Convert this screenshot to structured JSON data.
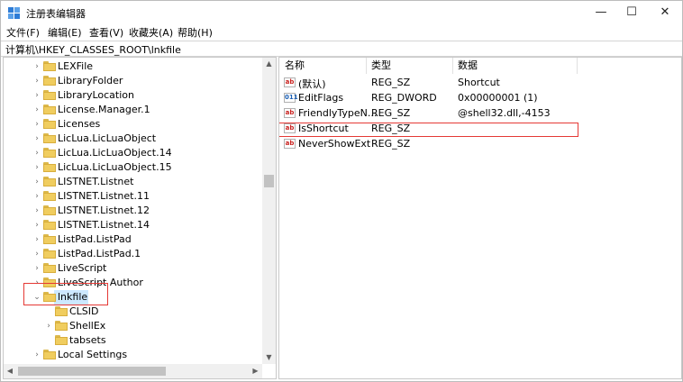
{
  "window": {
    "title": "注册表编辑器"
  },
  "menu": [
    "文件(F)",
    "编辑(E)",
    "查看(V)",
    "收藏夹(A)",
    "帮助(H)"
  ],
  "address": "计算机\\HKEY_CLASSES_ROOT\\lnkfile",
  "tree": [
    {
      "label": "LEXFile",
      "expander": "›"
    },
    {
      "label": "LibraryFolder",
      "expander": "›"
    },
    {
      "label": "LibraryLocation",
      "expander": "›"
    },
    {
      "label": "License.Manager.1",
      "expander": "›"
    },
    {
      "label": "Licenses",
      "expander": "›"
    },
    {
      "label": "LicLua.LicLuaObject",
      "expander": "›"
    },
    {
      "label": "LicLua.LicLuaObject.14",
      "expander": "›"
    },
    {
      "label": "LicLua.LicLuaObject.15",
      "expander": "›"
    },
    {
      "label": "LISTNET.Listnet",
      "expander": "›"
    },
    {
      "label": "LISTNET.Listnet.11",
      "expander": "›"
    },
    {
      "label": "LISTNET.Listnet.12",
      "expander": "›"
    },
    {
      "label": "LISTNET.Listnet.14",
      "expander": "›"
    },
    {
      "label": "ListPad.ListPad",
      "expander": "›"
    },
    {
      "label": "ListPad.ListPad.1",
      "expander": "›"
    },
    {
      "label": "LiveScript",
      "expander": "›"
    },
    {
      "label": "LiveScript Author",
      "expander": "›"
    },
    {
      "label": "lnkfile",
      "expander": "⌄",
      "selected": true
    },
    {
      "label": "CLSID",
      "expander": "",
      "child": true
    },
    {
      "label": "ShellEx",
      "expander": "›",
      "child": true
    },
    {
      "label": "tabsets",
      "expander": "",
      "child": true
    },
    {
      "label": "Local Settings",
      "expander": "›"
    }
  ],
  "columns": {
    "name": "名称",
    "type": "类型",
    "data": "数据"
  },
  "values": [
    {
      "icon": "ab",
      "name": "(默认)",
      "type": "REG_SZ",
      "data": "Shortcut"
    },
    {
      "icon": "bin",
      "name": "EditFlags",
      "type": "REG_DWORD",
      "data": "0x00000001 (1)"
    },
    {
      "icon": "ab",
      "name": "FriendlyTypeN...",
      "type": "REG_SZ",
      "data": "@shell32.dll,-4153"
    },
    {
      "icon": "ab",
      "name": "IsShortcut",
      "type": "REG_SZ",
      "data": ""
    },
    {
      "icon": "ab",
      "name": "NeverShowExt",
      "type": "REG_SZ",
      "data": ""
    }
  ],
  "icons": {
    "string_value": "ab",
    "binary_value": "011"
  },
  "colors": {
    "highlight": "#e53935",
    "selection": "#cce8ff",
    "folder": "#f0cd5f"
  }
}
